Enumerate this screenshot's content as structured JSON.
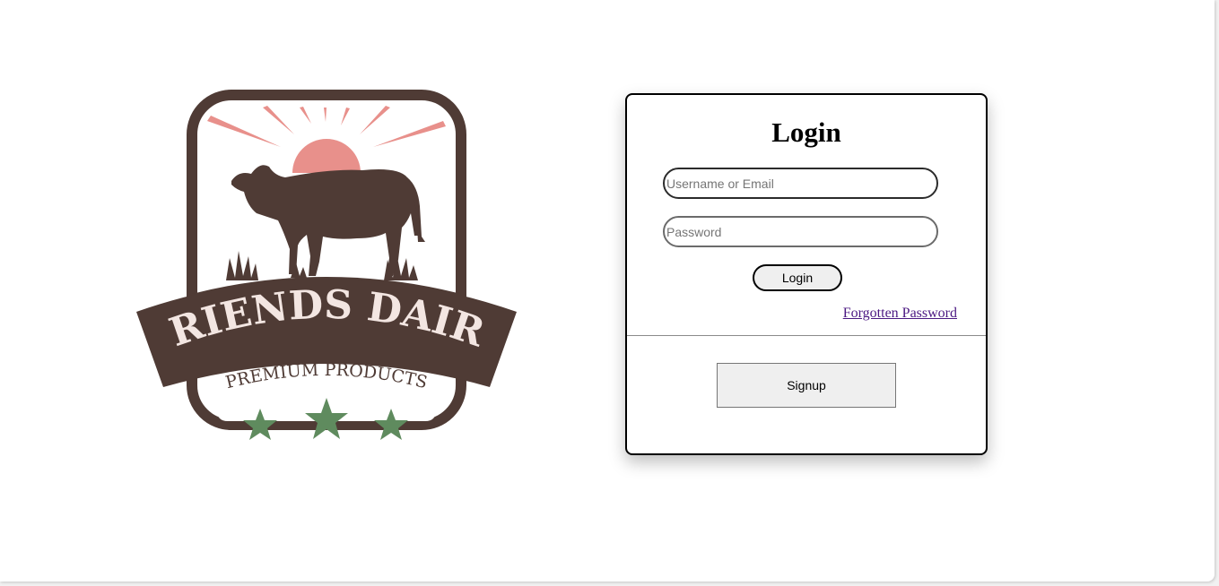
{
  "brand": {
    "logo_text": "FRIENDS DAIRY",
    "logo_subtext": "PREMIUM PRODUCTS",
    "colors": {
      "brown": "#4f3b35",
      "sun": "#e8908b",
      "star": "#5f8b5e",
      "cream": "#f3e6e2"
    }
  },
  "login": {
    "title": "Login",
    "username_placeholder": "Username or Email",
    "password_placeholder": "Password",
    "login_button": "Login",
    "forgot_link": "Forgotten Password",
    "signup_button": "Signup"
  }
}
